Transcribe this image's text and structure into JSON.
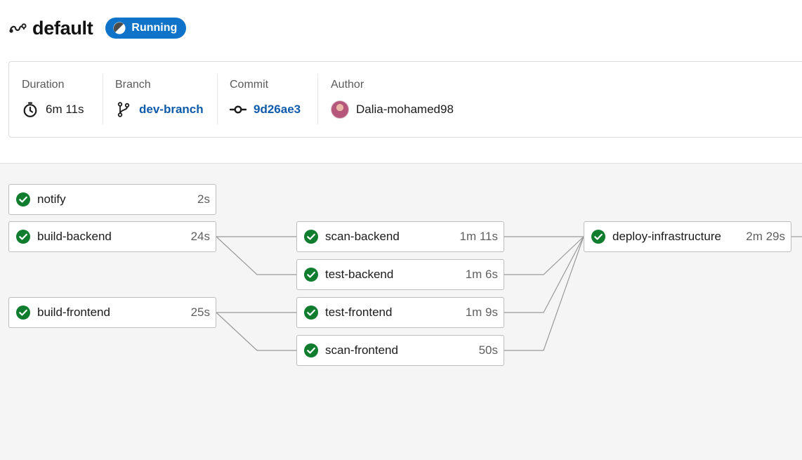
{
  "pipeline": {
    "title": "default",
    "status": "Running"
  },
  "summary": {
    "duration": {
      "label": "Duration",
      "value": "6m 11s"
    },
    "branch": {
      "label": "Branch",
      "value": "dev-branch"
    },
    "commit": {
      "label": "Commit",
      "value": "9d26ae3"
    },
    "author": {
      "label": "Author",
      "value": "Dalia-mohamed98"
    }
  },
  "jobs": [
    {
      "name": "notify",
      "duration": "2s",
      "status": "success"
    },
    {
      "name": "build-backend",
      "duration": "24s",
      "status": "success"
    },
    {
      "name": "build-frontend",
      "duration": "25s",
      "status": "success"
    },
    {
      "name": "scan-backend",
      "duration": "1m 11s",
      "status": "success"
    },
    {
      "name": "test-backend",
      "duration": "1m 6s",
      "status": "success"
    },
    {
      "name": "test-frontend",
      "duration": "1m 9s",
      "status": "success"
    },
    {
      "name": "scan-frontend",
      "duration": "50s",
      "status": "success"
    },
    {
      "name": "deploy-infrastructure",
      "duration": "2m 29s",
      "status": "success"
    }
  ],
  "colors": {
    "running_badge": "#0f74c9",
    "success": "#107c2e",
    "link": "#0f5bab"
  }
}
